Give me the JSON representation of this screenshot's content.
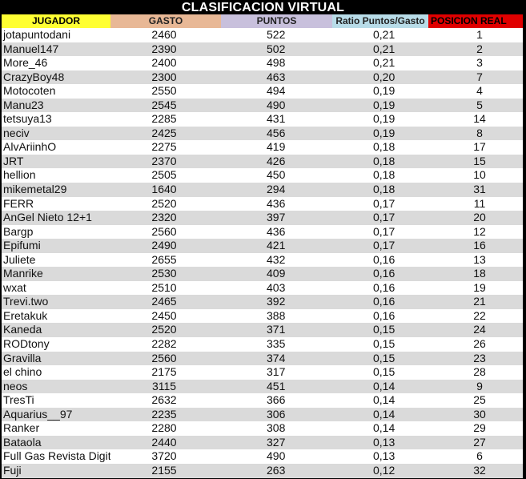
{
  "title": "CLASIFICACION VIRTUAL",
  "colors": {
    "title_bg": "#000000",
    "header_jugador": "#ffff33",
    "header_gasto": "#e8b896",
    "header_puntos": "#c8c0dc",
    "header_ratio": "#b8dce8",
    "header_posicion": "#e00000",
    "row_alt": "#dadada"
  },
  "headers": {
    "jugador": "JUGADOR",
    "gasto": "GASTO",
    "puntos": "PUNTOS",
    "ratio": "Ratio Puntos/Gasto",
    "posicion": "POSICION REAL"
  },
  "rows": [
    {
      "jugador": "jotapuntodani",
      "gasto": "2460",
      "puntos": "522",
      "ratio": "0,21",
      "posicion": "1"
    },
    {
      "jugador": "Manuel147",
      "gasto": "2390",
      "puntos": "502",
      "ratio": "0,21",
      "posicion": "2"
    },
    {
      "jugador": "More_46",
      "gasto": "2400",
      "puntos": "498",
      "ratio": "0,21",
      "posicion": "3"
    },
    {
      "jugador": "CrazyBoy48",
      "gasto": "2300",
      "puntos": "463",
      "ratio": "0,20",
      "posicion": "7"
    },
    {
      "jugador": "Motocoten",
      "gasto": "2550",
      "puntos": "494",
      "ratio": "0,19",
      "posicion": "4"
    },
    {
      "jugador": "Manu23",
      "gasto": "2545",
      "puntos": "490",
      "ratio": "0,19",
      "posicion": "5"
    },
    {
      "jugador": "tetsuya13",
      "gasto": "2285",
      "puntos": "431",
      "ratio": "0,19",
      "posicion": "14"
    },
    {
      "jugador": "neciv",
      "gasto": "2425",
      "puntos": "456",
      "ratio": "0,19",
      "posicion": "8"
    },
    {
      "jugador": "AlvAriinhO",
      "gasto": "2275",
      "puntos": "419",
      "ratio": "0,18",
      "posicion": "17"
    },
    {
      "jugador": "JRT",
      "gasto": "2370",
      "puntos": "426",
      "ratio": "0,18",
      "posicion": "15"
    },
    {
      "jugador": "hellion",
      "gasto": "2505",
      "puntos": "450",
      "ratio": "0,18",
      "posicion": "10"
    },
    {
      "jugador": "mikemetal29",
      "gasto": "1640",
      "puntos": "294",
      "ratio": "0,18",
      "posicion": "31"
    },
    {
      "jugador": "FERR",
      "gasto": "2520",
      "puntos": "436",
      "ratio": "0,17",
      "posicion": "11"
    },
    {
      "jugador": "AnGel Nieto 12+1",
      "gasto": "2320",
      "puntos": "397",
      "ratio": "0,17",
      "posicion": "20"
    },
    {
      "jugador": "Bargp",
      "gasto": "2560",
      "puntos": "436",
      "ratio": "0,17",
      "posicion": "12"
    },
    {
      "jugador": "Epifumi",
      "gasto": "2490",
      "puntos": "421",
      "ratio": "0,17",
      "posicion": "16"
    },
    {
      "jugador": "Juliete",
      "gasto": "2655",
      "puntos": "432",
      "ratio": "0,16",
      "posicion": "13"
    },
    {
      "jugador": "Manrike",
      "gasto": "2530",
      "puntos": "409",
      "ratio": "0,16",
      "posicion": "18"
    },
    {
      "jugador": "wxat",
      "gasto": "2510",
      "puntos": "403",
      "ratio": "0,16",
      "posicion": "19"
    },
    {
      "jugador": "Trevi.two",
      "gasto": "2465",
      "puntos": "392",
      "ratio": "0,16",
      "posicion": "21"
    },
    {
      "jugador": "Eretakuk",
      "gasto": "2450",
      "puntos": "388",
      "ratio": "0,16",
      "posicion": "22"
    },
    {
      "jugador": "Kaneda",
      "gasto": "2520",
      "puntos": "371",
      "ratio": "0,15",
      "posicion": "24"
    },
    {
      "jugador": "RODtony",
      "gasto": "2282",
      "puntos": "335",
      "ratio": "0,15",
      "posicion": "26"
    },
    {
      "jugador": "Gravilla",
      "gasto": "2560",
      "puntos": "374",
      "ratio": "0,15",
      "posicion": "23"
    },
    {
      "jugador": "el chino",
      "gasto": "2175",
      "puntos": "317",
      "ratio": "0,15",
      "posicion": "28"
    },
    {
      "jugador": "neos",
      "gasto": "3115",
      "puntos": "451",
      "ratio": "0,14",
      "posicion": "9"
    },
    {
      "jugador": "TresTi",
      "gasto": "2632",
      "puntos": "366",
      "ratio": "0,14",
      "posicion": "25"
    },
    {
      "jugador": "Aquarius__97",
      "gasto": "2235",
      "puntos": "306",
      "ratio": "0,14",
      "posicion": "30"
    },
    {
      "jugador": "Ranker",
      "gasto": "2280",
      "puntos": "308",
      "ratio": "0,14",
      "posicion": "29"
    },
    {
      "jugador": "Bataola",
      "gasto": "2440",
      "puntos": "327",
      "ratio": "0,13",
      "posicion": "27"
    },
    {
      "jugador": "Full Gas Revista Digit",
      "gasto": "3720",
      "puntos": "490",
      "ratio": "0,13",
      "posicion": "6"
    },
    {
      "jugador": "Fuji",
      "gasto": "2155",
      "puntos": "263",
      "ratio": "0,12",
      "posicion": "32"
    }
  ]
}
